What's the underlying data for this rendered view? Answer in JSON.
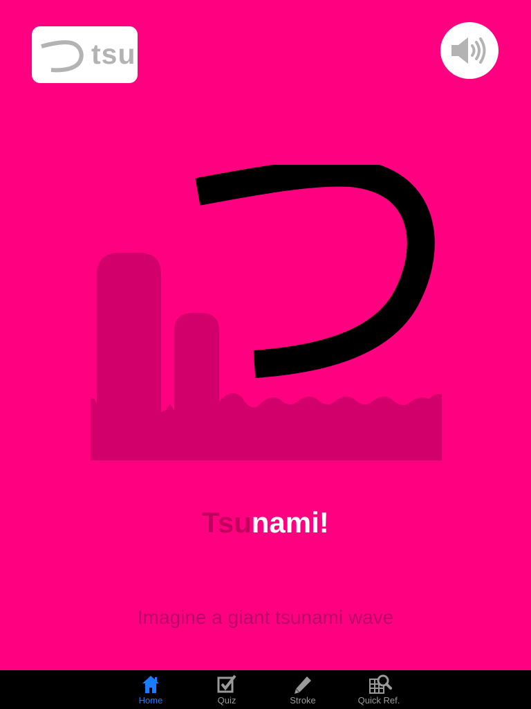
{
  "kana_card": {
    "kana": "つ",
    "romaji": "tsu"
  },
  "sound_button": {
    "icon": "speaker-icon"
  },
  "mnemonic": {
    "title_highlight": "Tsu",
    "title_rest": "nami!",
    "hint": "Imagine a giant tsunami wave"
  },
  "tabbar": {
    "tabs": [
      {
        "label": "Home",
        "icon": "home-icon",
        "active": true
      },
      {
        "label": "Quiz",
        "icon": "checkbox-icon",
        "active": false
      },
      {
        "label": "Stroke",
        "icon": "pencil-icon",
        "active": false
      },
      {
        "label": "Quick Ref.",
        "icon": "grid-search-icon",
        "active": false
      }
    ]
  },
  "colors": {
    "background": "#ff0080",
    "title_highlight": "#bf005d",
    "active_tab": "#1a7cff"
  }
}
